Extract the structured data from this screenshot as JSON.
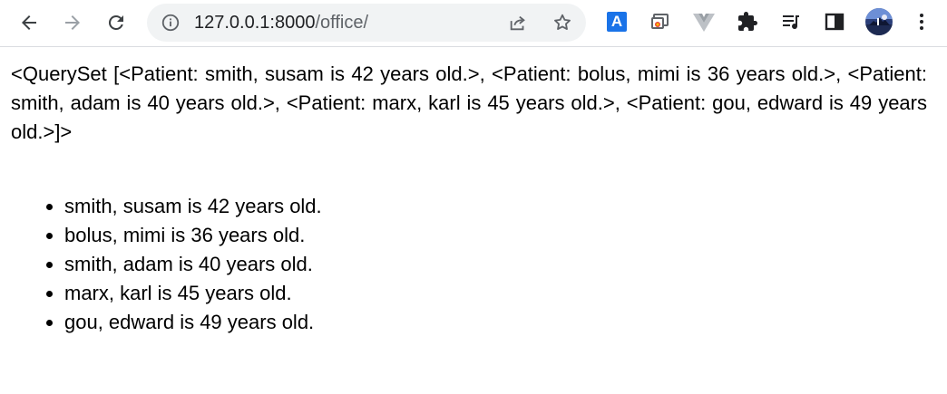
{
  "browser": {
    "url_host": "127.0.0.1:8000",
    "url_path": "/office/",
    "back_icon": "arrow-left-icon",
    "forward_icon": "arrow-right-icon",
    "reload_icon": "reload-icon",
    "site_info_icon": "info-icon",
    "share_icon": "share-icon",
    "bookmark_icon": "star-icon",
    "extension_badge_text": "A"
  },
  "page": {
    "queryset_text": "<QuerySet [<Patient: smith, susam is 42 years old.>, <Patient: bolus, mimi is 36 years old.>, <Patient: smith, adam is 40 years old.>, <Patient: marx, karl is 45 years old.>, <Patient: gou, edward is 49 years old.>]>",
    "patients": [
      "smith, susam is 42 years old.",
      "bolus, mimi is 36 years old.",
      "smith, adam is 40 years old.",
      "marx, karl is 45 years old.",
      "gou, edward is 49 years old."
    ]
  },
  "colors": {
    "toolbar_icon": "#3c4043",
    "omnibox_bg": "#f1f3f4",
    "translate_blue": "#1a73e8"
  }
}
